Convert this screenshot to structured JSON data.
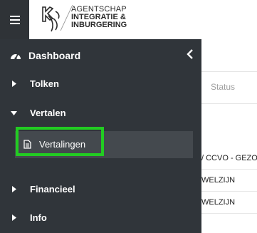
{
  "header": {
    "logo_line1": "AGENTSCHAP",
    "logo_line2": "INTEGRATIE &",
    "logo_line3": "INBURGERING"
  },
  "sidebar": {
    "dashboard_label": "Dashboard",
    "items": [
      {
        "label": "Tolken",
        "expanded": false
      },
      {
        "label": "Vertalen",
        "expanded": true
      },
      {
        "label": "Financieel",
        "expanded": false
      },
      {
        "label": "Info",
        "expanded": false
      }
    ],
    "subitem_label": "Vertalingen"
  },
  "table": {
    "status_header": "Status",
    "rows": [
      "/ CCVO - GEZO",
      "WELZIJN",
      "WELZIJN"
    ]
  },
  "colors": {
    "sidebar_bg": "#30353a",
    "active_item_bg": "#44494e",
    "highlight": "#22cc22"
  }
}
